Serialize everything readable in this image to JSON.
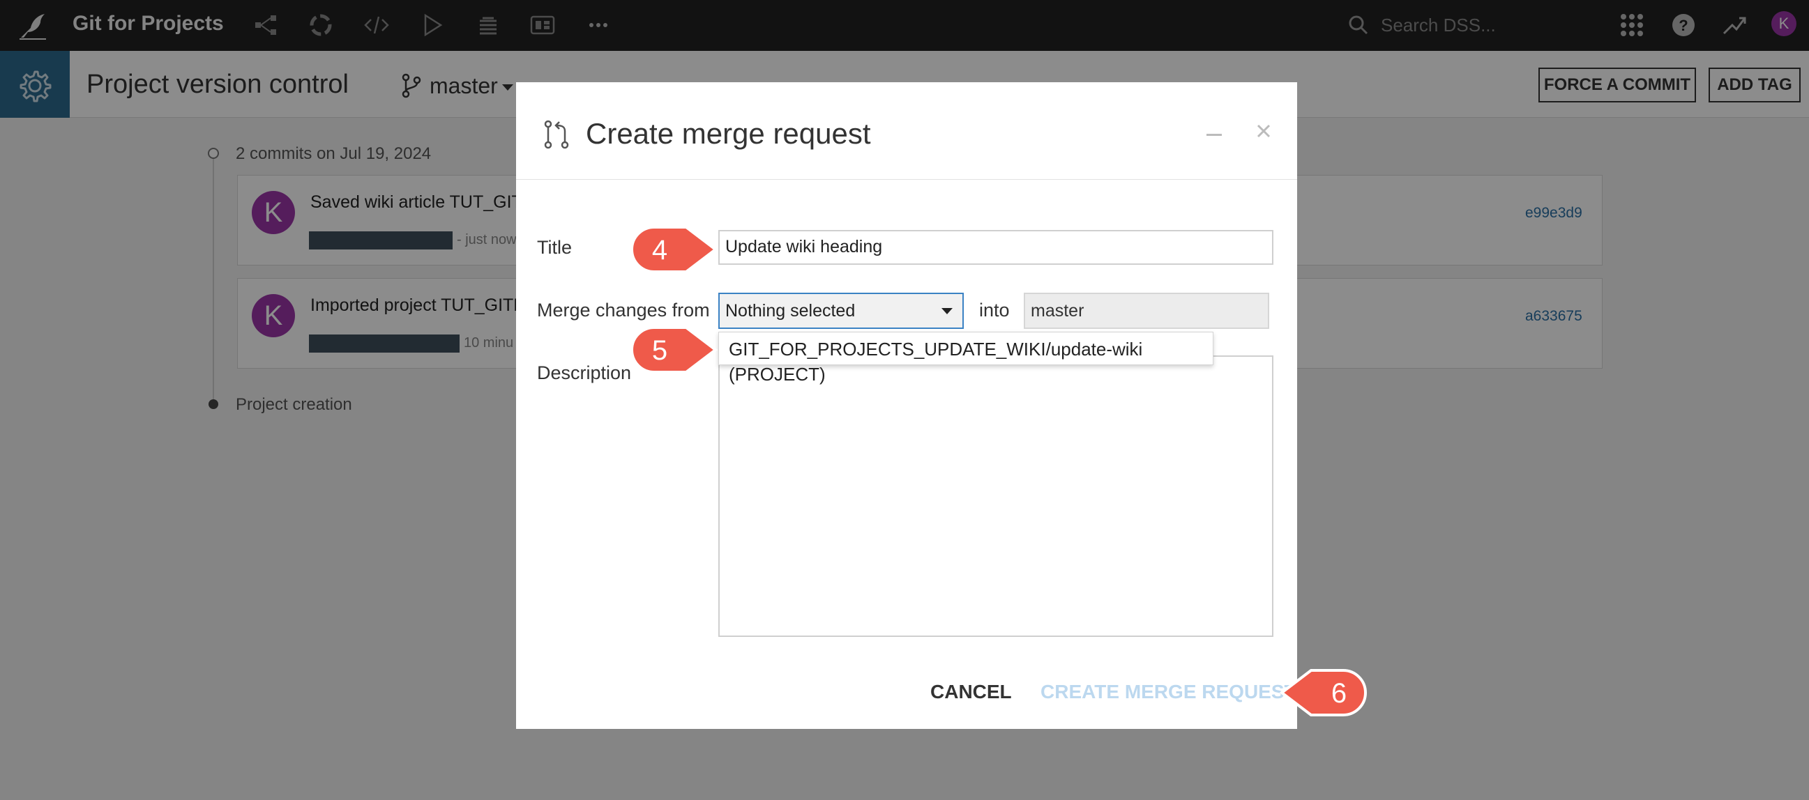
{
  "topbar": {
    "project_name": "Git for Projects",
    "search_placeholder": "Search DSS...",
    "user_initial": "K"
  },
  "subheader": {
    "page_title": "Project version control",
    "branch": "master",
    "force_commit_label": "FORCE A COMMIT",
    "add_tag_label": "ADD TAG"
  },
  "timeline": {
    "date_label": "2 commits on Jul 19, 2024",
    "commits": [
      {
        "author_initial": "K",
        "message": "Saved wiki article TUT_GIT",
        "when": "- just now",
        "hash": "e99e3d9"
      },
      {
        "author_initial": "K",
        "message": "Imported project TUT_GITF",
        "when": "10 minu",
        "hash": "a633675"
      }
    ],
    "creation_label": "Project creation"
  },
  "modal": {
    "title": "Create merge request",
    "title_label": "Title",
    "title_value": "Update wiki heading",
    "merge_from_label": "Merge changes from",
    "merge_from_value": "Nothing selected",
    "into_label": "into",
    "into_value": "master",
    "dropdown_option": "GIT_FOR_PROJECTS_UPDATE_WIKI/update-wiki (PROJECT)",
    "description_label": "Description",
    "cancel_label": "CANCEL",
    "create_label": "CREATE MERGE REQUEST"
  },
  "callouts": {
    "step_4": "4",
    "step_5": "5",
    "step_6": "6",
    "color": "#ef5a4a"
  }
}
